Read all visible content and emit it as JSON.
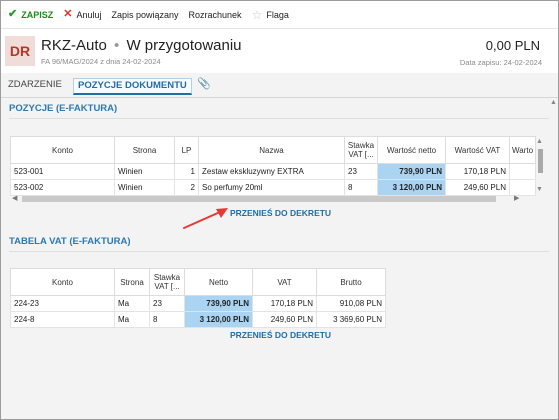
{
  "toolbar": {
    "save": "ZAPISZ",
    "cancel": "Anuluj",
    "linked": "Zapis powiązany",
    "settlement": "Rozrachunek",
    "flag": "Flaga"
  },
  "header": {
    "avatar": "DR",
    "title": "RKZ-Auto",
    "dot": "•",
    "status": "W przygotowaniu",
    "subtitle": "FA 96/MAG/2024 z dnia 24-02-2024",
    "amount": "0,00 PLN",
    "date": "Data zapisu: 24-02-2024"
  },
  "tabs": {
    "event": "ZDARZENIE",
    "positions": "POZYCJE DOKUMENTU"
  },
  "positions": {
    "title": "POZYCJE (E-FAKTURA)",
    "columns": {
      "konto": "Konto",
      "strona": "Strona",
      "lp": "LP",
      "nazwa": "Nazwa",
      "stawka1": "Stawka",
      "stawka2": "VAT [...",
      "netto": "Wartość netto",
      "vat": "Wartość VAT",
      "more": "Warto"
    },
    "rows": [
      {
        "konto": "523-001",
        "strona": "Winien",
        "lp": "1",
        "nazwa": "Zestaw ekskluzywny EXTRA",
        "stawka": "23",
        "netto": "739,90 PLN",
        "vat": "170,18 PLN",
        "more": ""
      },
      {
        "konto": "523-002",
        "strona": "Winien",
        "lp": "2",
        "nazwa": "So perfumy 20ml",
        "stawka": "8",
        "netto": "3 120,00 PLN",
        "vat": "249,60 PLN",
        "more": ""
      }
    ],
    "move_link": "PRZENIEŚ DO DEKRETU"
  },
  "vat": {
    "title": "TABELA VAT (E-FAKTURA)",
    "columns": {
      "konto": "Konto",
      "strona": "Strona",
      "stawka1": "Stawka",
      "stawka2": "VAT [...",
      "netto": "Netto",
      "vat": "VAT",
      "brutto": "Brutto"
    },
    "rows": [
      {
        "konto": "224-23",
        "strona": "Ma",
        "stawka": "23",
        "netto": "739,90 PLN",
        "vat": "170,18 PLN",
        "brutto": "910,08 PLN"
      },
      {
        "konto": "224-8",
        "strona": "Ma",
        "stawka": "8",
        "netto": "3 120,00 PLN",
        "vat": "249,60 PLN",
        "brutto": "3 369,60 PLN"
      }
    ],
    "move_link": "PRZENIEŚ DO DEKRETU"
  },
  "colors": {
    "accent": "#1f6ea8",
    "highlight": "#aad4f2",
    "save_green": "#1a8a1a",
    "cancel_red": "#d9352a",
    "avatar_bg": "#f0ddd9",
    "avatar_text": "#b73626",
    "annotation_arrow": "#e53935"
  },
  "icons": {
    "save": "check-icon",
    "cancel": "x-icon",
    "flag": "star-icon",
    "attachment": "paperclip-icon"
  }
}
